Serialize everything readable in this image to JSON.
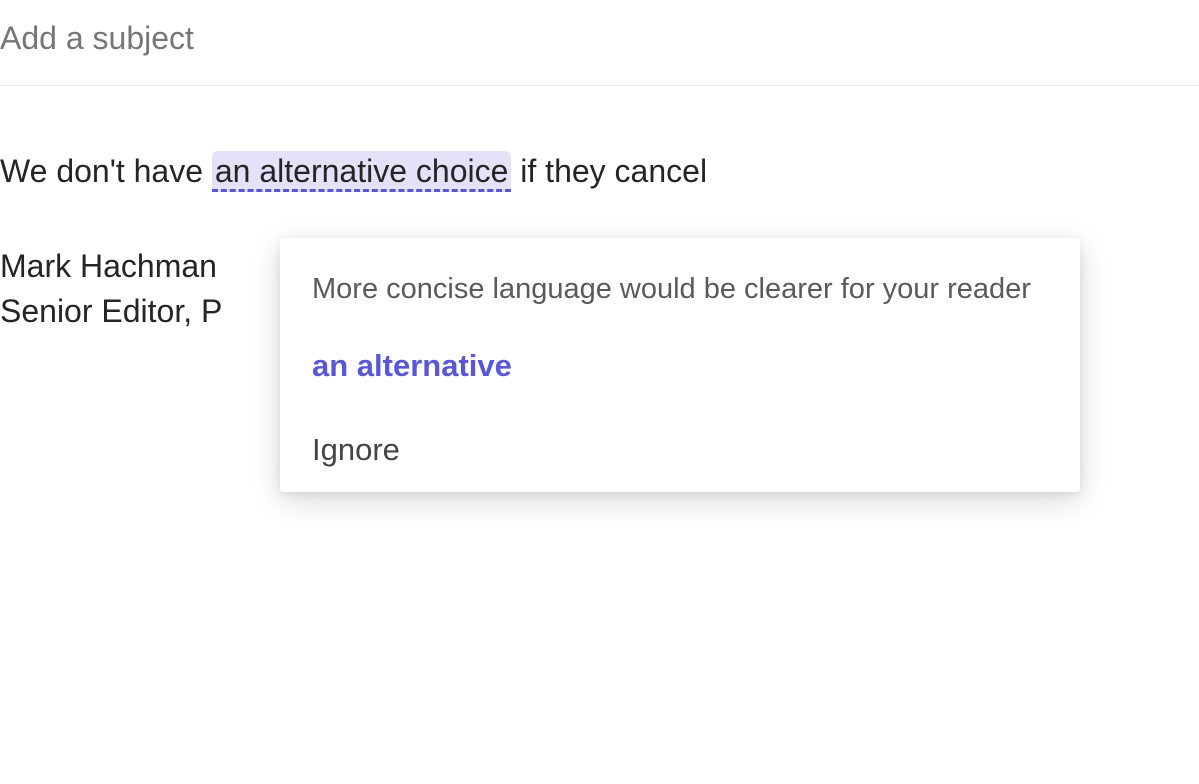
{
  "subject": {
    "placeholder": "Add a subject"
  },
  "body": {
    "text_before": "We don't have ",
    "flagged_phrase": "an alternative choice",
    "text_after": " if they cancel"
  },
  "signature": {
    "line1": "Mark Hachman",
    "line2": "Senior Editor, P"
  },
  "suggestion": {
    "description": "More concise language would be clearer for your reader",
    "replacement": "an alternative",
    "ignore_label": "Ignore"
  }
}
